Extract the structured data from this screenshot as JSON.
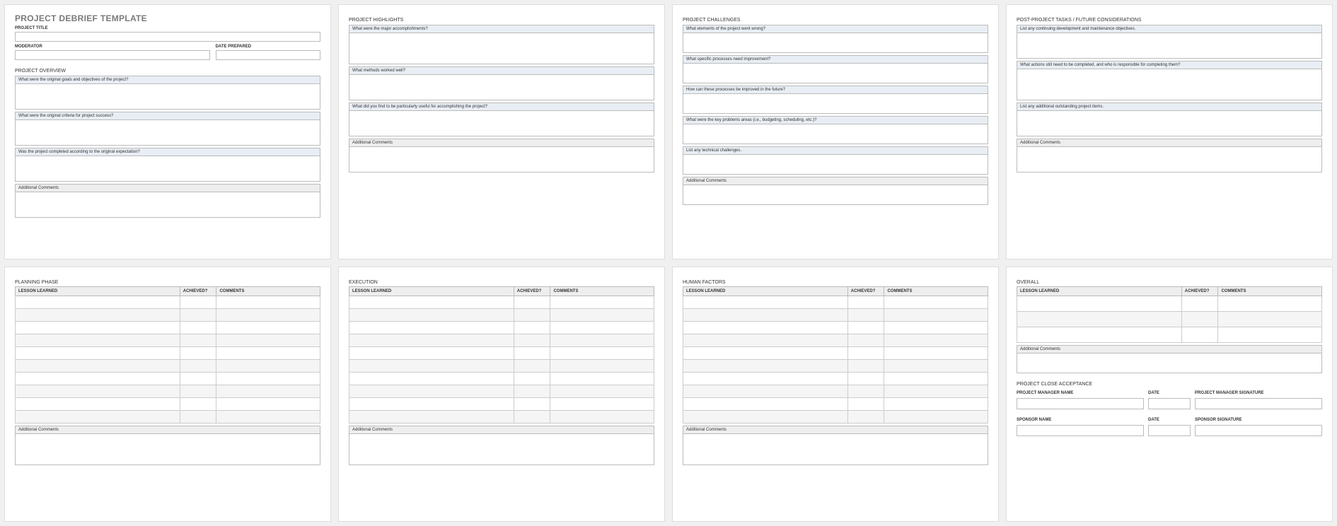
{
  "doc_title": "PROJECT DEBRIEF TEMPLATE",
  "page1": {
    "project_title_label": "PROJECT TITLE",
    "moderator_label": "MODERATOR",
    "date_prepared_label": "DATE PREPARED",
    "overview_title": "PROJECT OVERVIEW",
    "q1": "What were the original goals and objectives of the project?",
    "q2": "What were the original criteria for project success?",
    "q3": "Was the project completed according to the original expectation?",
    "additional": "Additional Comments"
  },
  "page2": {
    "title": "PROJECT HIGHLIGHTS",
    "q1": "What were the major accomplishments?",
    "q2": "What methods worked well?",
    "q3": "What did you find to be particularly useful for accomplishing the project?",
    "additional": "Additional Comments"
  },
  "page3": {
    "title": "PROJECT CHALLENGES",
    "q1": "What elements of the project went wrong?",
    "q2": "What specific processes need improvement?",
    "q3": "How can these processes be improved in the future?",
    "q4": "What were the key problems areas (i.e., budgeting, scheduling, etc.)?",
    "q5": "List any technical challenges.",
    "additional": "Additional Comments"
  },
  "page4": {
    "title": "POST-PROJECT TASKS / FUTURE CONSIDERATIONS",
    "q1": "List any continuing development and maintenance objectives.",
    "q2": "What actions still need to be completed, and who is responsible for completing them?",
    "q3": "List any additional outstanding project items.",
    "additional": "Additional Comments"
  },
  "lessons_headers": {
    "col1": "LESSON LEARNED",
    "col2": "ACHIEVED?",
    "col3": "COMMENTS"
  },
  "page5": {
    "title": "PLANNING PHASE",
    "additional": "Additional Comments"
  },
  "page6": {
    "title": "EXECUTION",
    "additional": "Additional Comments"
  },
  "page7": {
    "title": "HUMAN FACTORS",
    "additional": "Additional Comments"
  },
  "page8": {
    "title": "OVERALL",
    "additional": "Additional Comments",
    "close_title": "PROJECT CLOSE ACCEPTANCE",
    "pm_name": "PROJECT MANAGER NAME",
    "date": "DATE",
    "pm_sig": "PROJECT MANAGER SIGNATURE",
    "sponsor_name": "SPONSOR NAME",
    "sponsor_sig": "SPONSOR SIGNATURE"
  }
}
